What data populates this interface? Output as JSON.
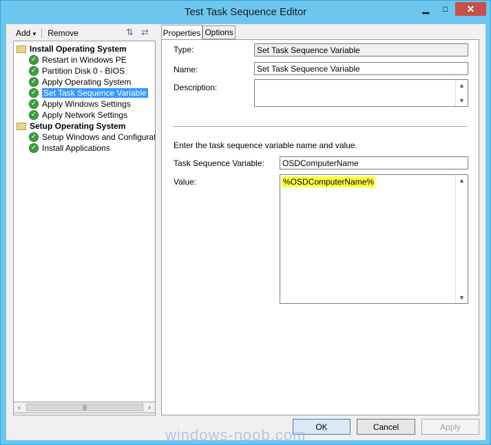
{
  "window": {
    "title": "Test Task Sequence Editor"
  },
  "toolbar": {
    "add_label": "Add",
    "add_arrow": "▾",
    "remove_label": "Remove"
  },
  "tree": {
    "groups": [
      {
        "label": "Install Operating System",
        "items": [
          "Restart in Windows PE",
          "Partition Disk 0 - BIOS",
          "Apply Operating System",
          "Set Task Sequence Variable",
          "Apply Windows Settings",
          "Apply Network Settings"
        ]
      },
      {
        "label": "Setup Operating System",
        "items": [
          "Setup Windows and Configuration",
          "Install Applications"
        ]
      }
    ],
    "selected_item": "Set Task Sequence Variable"
  },
  "tabs": {
    "properties": "Properties",
    "options": "Options"
  },
  "form": {
    "type_label": "Type:",
    "type_value": "Set Task Sequence Variable",
    "name_label": "Name:",
    "name_value": "Set Task Sequence Variable",
    "description_label": "Description:",
    "description_value": "",
    "instruction": "Enter the task sequence variable name and value.",
    "variable_label": "Task Sequence Variable:",
    "variable_value": "OSDComputerName",
    "value_label": "Value:",
    "value_value": "%OSDComputerName%"
  },
  "buttons": {
    "ok": "OK",
    "cancel": "Cancel",
    "apply": "Apply"
  },
  "watermark": "windows-noob.com"
}
